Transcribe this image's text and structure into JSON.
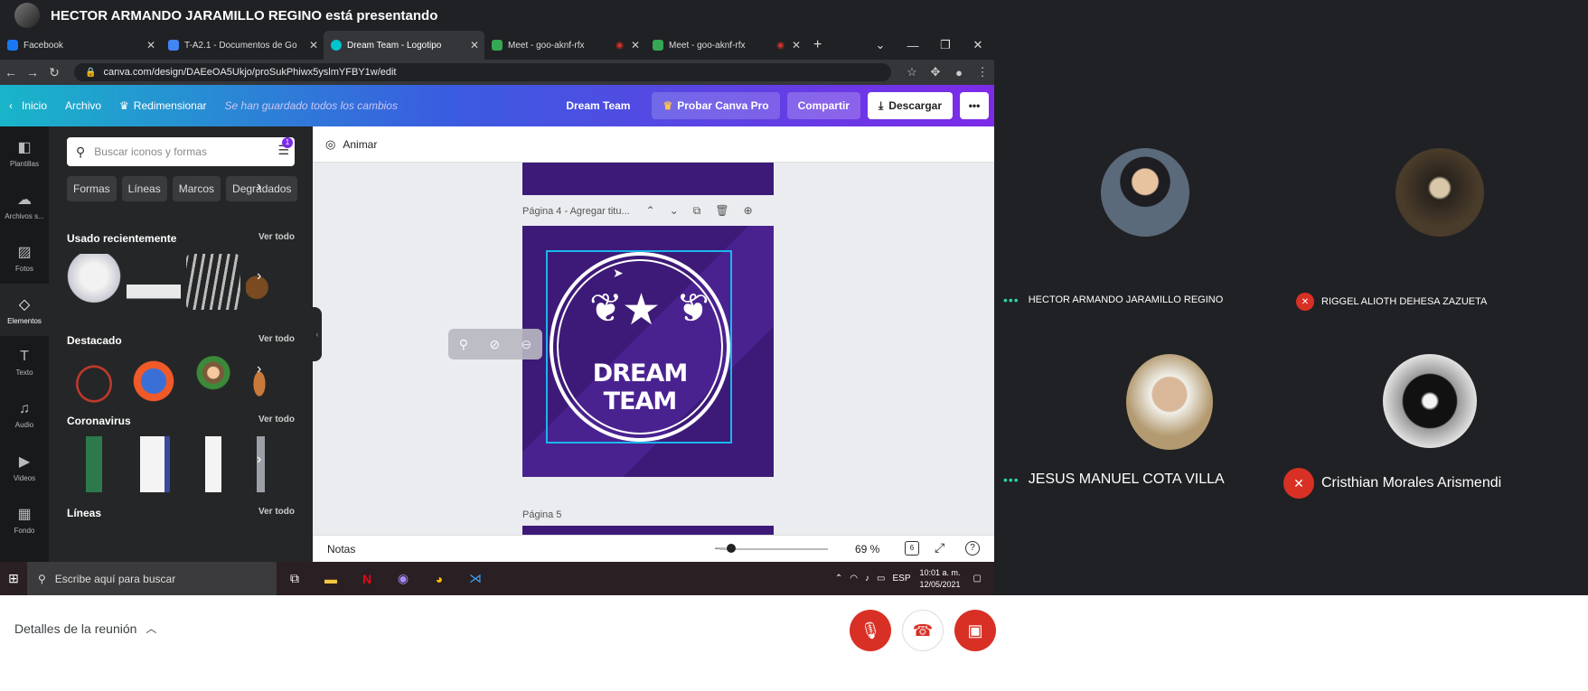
{
  "presenting": {
    "title": "HECTOR ARMANDO JARAMILLO REGINO está presentando"
  },
  "browser": {
    "tabs": [
      {
        "label": "Facebook",
        "color": "#1877f2"
      },
      {
        "label": "T-A2.1 - Documentos de Go",
        "color": "#4285f4"
      },
      {
        "label": "Dream Team - Logotipo",
        "color": "#00c4cc"
      },
      {
        "label": "Meet - goo-aknf-rfx",
        "color": "#34a853"
      },
      {
        "label": "Meet - goo-aknf-rfx",
        "color": "#34a853"
      }
    ],
    "url": "canva.com/design/DAEeOA5Ukjo/proSukPhiwx5yslmYFBY1w/edit"
  },
  "canva": {
    "header": {
      "home": "Inicio",
      "file": "Archivo",
      "resize": "Redimensionar",
      "saved": "Se han guardado todos los cambios",
      "project_name": "Dream Team",
      "try_pro": "Probar Canva Pro",
      "share": "Compartir",
      "download": "Descargar"
    },
    "rail": [
      {
        "label": "Plantillas",
        "icon": "templates-icon"
      },
      {
        "label": "Archivos s...",
        "icon": "upload-icon"
      },
      {
        "label": "Fotos",
        "icon": "photos-icon"
      },
      {
        "label": "Elementos",
        "icon": "elements-icon"
      },
      {
        "label": "Texto",
        "icon": "text-icon"
      },
      {
        "label": "Audio",
        "icon": "audio-icon"
      },
      {
        "label": "Videos",
        "icon": "video-icon"
      },
      {
        "label": "Fondo",
        "icon": "background-icon"
      }
    ],
    "panel": {
      "search_placeholder": "Buscar iconos y formas",
      "filter_badge": "1",
      "chips": [
        "Formas",
        "Líneas",
        "Marcos",
        "Degradados"
      ],
      "sections": [
        {
          "title": "Usado recientemente",
          "see_all": "Ver todo"
        },
        {
          "title": "Destacado",
          "see_all": "Ver todo"
        },
        {
          "title": "Coronavirus",
          "see_all": "Ver todo"
        },
        {
          "title": "Líneas",
          "see_all": "Ver todo"
        }
      ]
    },
    "animate": "Animar",
    "page4_label": "Página 4 - Agregar titu...",
    "page5_label": "Página 5",
    "logo_text": "DREAM TEAM",
    "notes": "Notas",
    "zoom": "69 %",
    "pages_count": "6"
  },
  "taskbar": {
    "search_placeholder": "Escribe aquí para buscar",
    "lang": "ESP",
    "time": "10:01 a. m.",
    "date": "12/05/2021"
  },
  "participants": [
    {
      "name": "HECTOR ARMANDO JARAMILLO REGINO",
      "muted": false
    },
    {
      "name": "RIGGEL ALIOTH DEHESA ZAZUETA",
      "muted": true
    },
    {
      "name": "JESUS MANUEL COTA VILLA",
      "muted": false
    },
    {
      "name": "Cristhian Morales Arismendi",
      "muted": true
    }
  ],
  "meet": {
    "details": "Detalles de la reunión"
  }
}
